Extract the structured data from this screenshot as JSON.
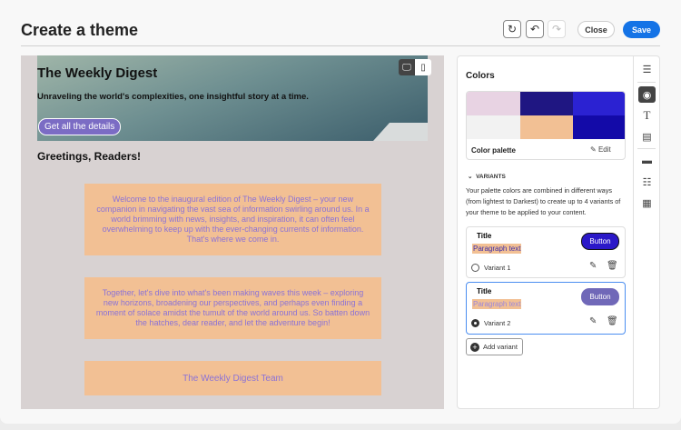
{
  "header": {
    "title": "Create a theme",
    "close_label": "Close",
    "save_label": "Save"
  },
  "preview": {
    "heading": "The Weekly Digest",
    "subheading": "Unraveling the world's complexities, one insightful story at a time.",
    "cta_label": "Get all the details",
    "greeting": "Greetings, Readers!",
    "blocks": [
      "Welcome to the inaugural edition of The Weekly Digest – your new companion in navigating the vast sea of information swirling around us. In a world brimming with news, insights, and inspiration, it can often feel overwhelming to keep up with the ever-changing currents of information. That's where we come in.",
      "Together, let's dive into what's been making waves this week – exploring new horizons, broadening our perspectives, and perhaps even finding a moment of solace amidst the tumult of the world around us. So batten down the hatches, dear reader, and let the adventure begin!",
      "The Weekly Digest Team"
    ]
  },
  "panel": {
    "title": "Colors",
    "palette_label": "Color palette",
    "edit_label": "Edit",
    "palette_colors": [
      "#e8d3e3",
      "#1f1682",
      "#2b22d2",
      "#f2f2f2",
      "#f2c094",
      "#130aa8"
    ],
    "variants_header": "VARIANTS",
    "variants_desc": "Your palette colors are combined in different ways (from lightest to Darkest) to create up to 4 variants of your theme to be applied to your content.",
    "variants": [
      {
        "title": "Title",
        "paragraph": "Paragraph text",
        "button": "Button",
        "name": "Variant 1",
        "button_color": "#2b18c8",
        "para_color": "#3b2aa8"
      },
      {
        "title": "Title",
        "paragraph": "Paragraph text",
        "button": "Button",
        "name": "Variant 2",
        "button_color": "#7068b8",
        "para_color": "#9a86dc"
      }
    ],
    "add_variant_label": "Add variant"
  },
  "colors": {
    "accent": "#1473e6"
  }
}
